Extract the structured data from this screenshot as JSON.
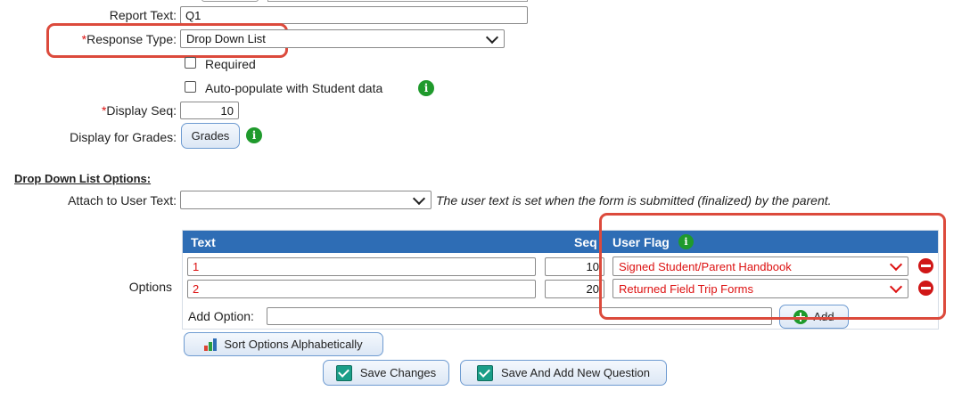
{
  "form": {
    "report_text_label": "Report Text:",
    "report_text_value": "Q1",
    "required_star": "*",
    "response_type_label": "Response Type:",
    "response_type_value": "Drop Down List",
    "required_label": "Required",
    "autopopulate_label": "Auto-populate with Student data",
    "display_seq_label": "Display Seq:",
    "display_seq_value": "10",
    "display_grades_label": "Display for Grades:",
    "grades_button": "Grades"
  },
  "dropdown_options": {
    "section_title": "Drop Down List Options:",
    "attach_label": "Attach to User Text:",
    "attach_value": "",
    "attach_note": "The user text is set when the form is submitted (finalized) by the parent.",
    "options_label": "Options",
    "columns": {
      "text": "Text",
      "seq": "Seq",
      "user_flag": "User Flag"
    },
    "rows": [
      {
        "text": "1",
        "seq": "10",
        "user_flag": "Signed Student/Parent Handbook"
      },
      {
        "text": "2",
        "seq": "20",
        "user_flag": "Returned Field Trip Forms"
      }
    ],
    "add_option_label": "Add Option:",
    "add_option_value": "",
    "add_button": "Add",
    "sort_button": "Sort Options Alphabetically"
  },
  "actions": {
    "save_changes": "Save Changes",
    "save_and_add": "Save And Add New Question"
  },
  "colors": {
    "table_header": "#2e6db5",
    "highlight_box": "#dc4a3c",
    "info_icon": "#1f9a2c",
    "error_text": "#d11111"
  }
}
